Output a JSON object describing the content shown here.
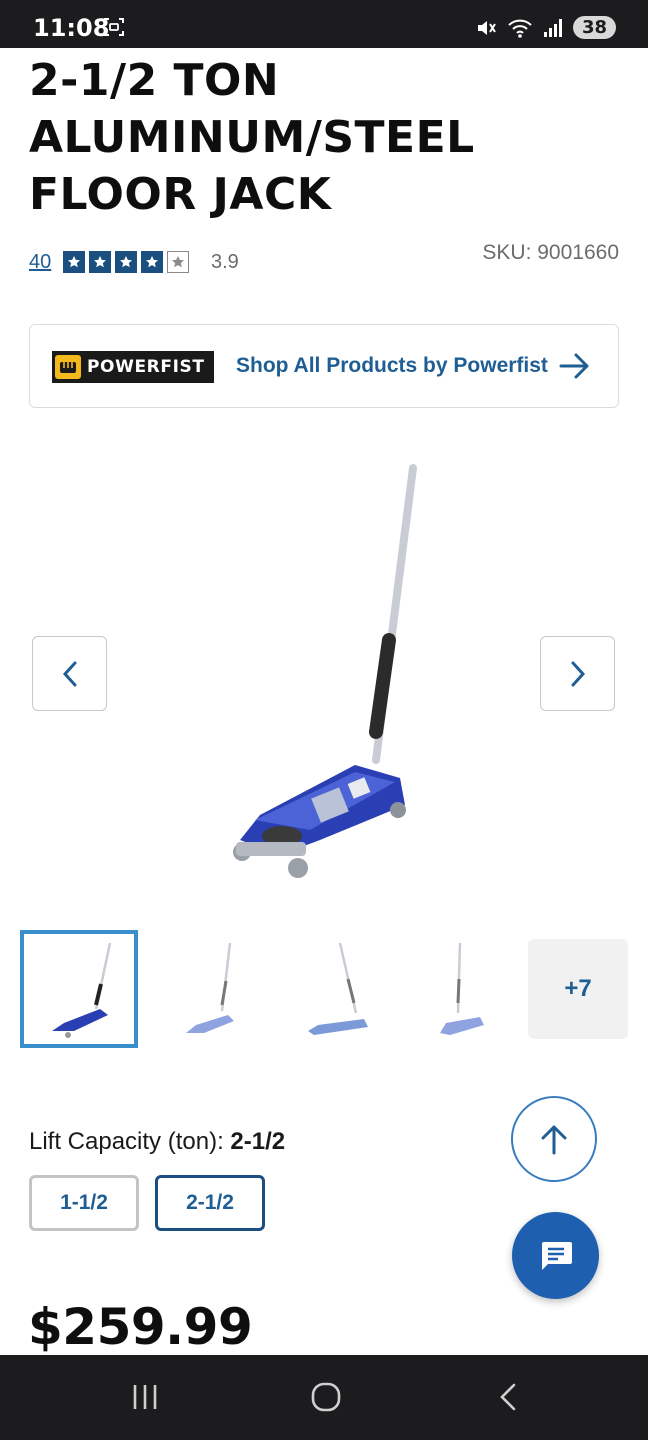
{
  "status_bar": {
    "time": "11:08",
    "battery": "38"
  },
  "product": {
    "title": "2-1/2 TON ALUMINUM/STEEL FLOOR JACK",
    "review_count": "40",
    "rating": "3.9",
    "stars_filled": 4,
    "stars_total": 5,
    "sku": "SKU: 9001660",
    "price": "$259.99"
  },
  "brand": {
    "logo_text": "POWERFIST",
    "link_text": "Shop All Products by Powerfist"
  },
  "gallery": {
    "more_count": "+7"
  },
  "options": {
    "label": "Lift Capacity (ton): ",
    "selected_value": "2-1/2",
    "values": [
      "1-1/2",
      "2-1/2"
    ]
  },
  "colors": {
    "accent_blue": "#1f5e94",
    "dark_navy": "#1a4f80",
    "chat_blue": "#1f5fb0",
    "thumb_active": "#3a8fca"
  },
  "icons": {
    "prev": "chevron-left-icon",
    "next": "chevron-right-icon",
    "brand_arrow": "arrow-right-icon",
    "scroll_top": "arrow-up-icon",
    "chat": "chat-bubble-icon"
  }
}
